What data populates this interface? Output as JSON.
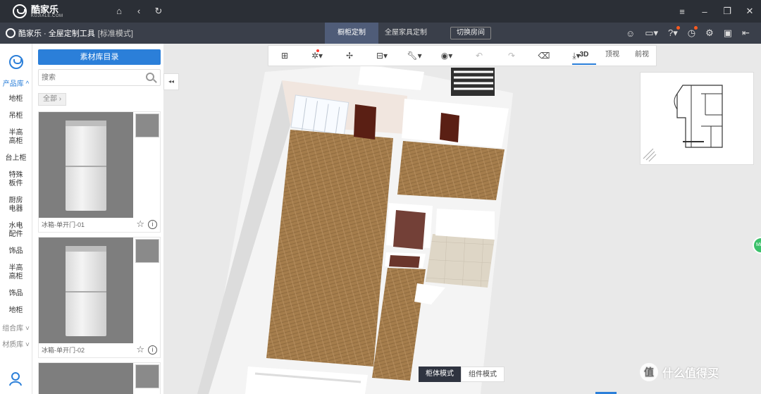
{
  "titlebar": {
    "logo_main": "酷家乐",
    "logo_sub": "KUJIALE.COM",
    "nav_icons": [
      "home-icon",
      "back-icon",
      "refresh-icon"
    ],
    "window_icons": [
      "menu-icon",
      "minimize-icon",
      "restore-icon",
      "close-icon"
    ]
  },
  "appbar": {
    "title": "酷家乐 · 全屋定制工具",
    "mode": "[标准模式]",
    "tabs": [
      {
        "label": "橱柜定制",
        "active": true
      },
      {
        "label": "全屋家具定制",
        "active": false
      }
    ],
    "switch_room": "切换房间",
    "icons": [
      "service-icon",
      "message-icon",
      "help-icon",
      "history-icon",
      "settings-icon",
      "save-icon",
      "exit-icon"
    ]
  },
  "rail": {
    "product_lib": "产品库",
    "items": [
      "地柜",
      "吊柜",
      "半高\n高柜",
      "台上柜",
      "特殊\n板件",
      "厨房\n电器",
      "水电\n配件",
      "饰品",
      "半高\n高柜",
      "饰品",
      "地柜"
    ],
    "combo_lib": "组合库",
    "material_lib": "材质库"
  },
  "library": {
    "catalog_button": "素材库目录",
    "search_placeholder": "搜索",
    "filter": "全部",
    "cards": [
      {
        "name": "冰箱-单开门-01"
      },
      {
        "name": "冰箱-单开门-02"
      }
    ]
  },
  "collapse_label": "◂◂",
  "toolbar": {
    "tools": [
      "layout-icon",
      "lighting-icon",
      "fan-icon",
      "cabinet-icon",
      "wrench-icon",
      "eye-icon",
      "undo-icon",
      "redo-icon",
      "eraser-icon",
      "download-icon"
    ],
    "views": [
      "3D",
      "顶视",
      "前视"
    ],
    "active_view": "3D"
  },
  "mode_switch": {
    "active": "柜体模式",
    "inactive": "组件模式"
  },
  "watermark": {
    "badge": "值",
    "text": "什么值得买"
  },
  "green_button": "Min",
  "colors": {
    "accent": "#2b7fd9",
    "titlebar": "#2b2f36",
    "appbar": "#3a3f4a",
    "active_tab": "#4f5c78",
    "floor_wood": "#a07a4a",
    "door": "#5a1f14"
  }
}
